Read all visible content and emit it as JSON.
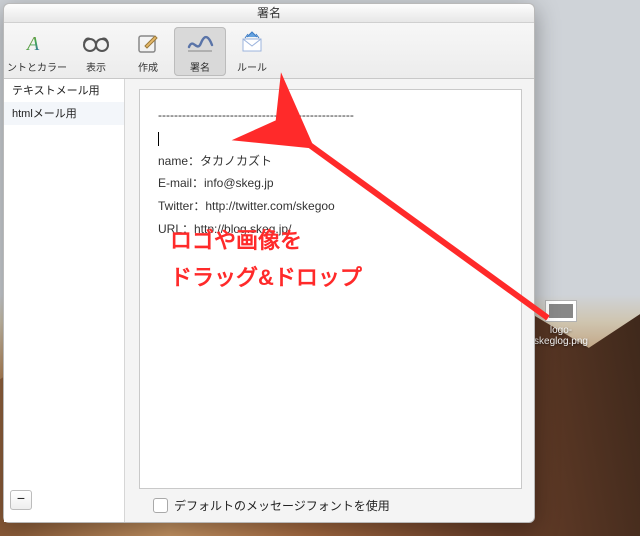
{
  "window": {
    "title": "署名"
  },
  "toolbar": {
    "fonts_colors": "ントとカラー",
    "show": "表示",
    "compose": "作成",
    "signature": "署名",
    "rules": "ルール"
  },
  "sidebar": {
    "items": [
      {
        "label": "テキストメール用"
      },
      {
        "label": "htmlメール用"
      }
    ]
  },
  "signature": {
    "divider": "-------------------------------------------------",
    "name_line": "name：タカノカズト",
    "email_line": "E-mail：info@skeg.jp",
    "twitter_line": "Twitter：http://twitter.com/skegoo",
    "url_line": "URL：http://blog.skeg.jp/"
  },
  "footer": {
    "default_font_label": "デフォルトのメッセージフォントを使用",
    "remove_label": "−"
  },
  "desktop": {
    "file_name": "logo-\nskeglog.png"
  },
  "annotation": {
    "line1": "ロゴや画像を",
    "line2": "ドラッグ&ドロップ"
  }
}
